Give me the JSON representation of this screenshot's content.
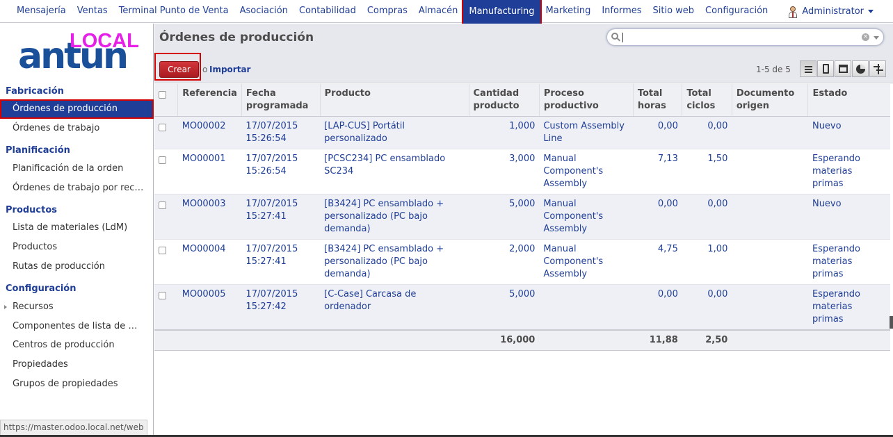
{
  "topbar": {
    "menu": [
      "Mensajería",
      "Ventas",
      "Terminal Punto de Venta",
      "Asociación",
      "Contabilidad",
      "Compras",
      "Almacén",
      "Manufacturing",
      "Marketing",
      "Informes",
      "Sitio web",
      "Configuración"
    ],
    "active": "Manufacturing",
    "user": "Administrator"
  },
  "logo": {
    "brand": "antun",
    "badge": "LOCAL"
  },
  "sidebar": {
    "sections": [
      {
        "title": "Fabricación",
        "items": [
          "Órdenes de producción",
          "Órdenes de trabajo"
        ]
      },
      {
        "title": "Planificación",
        "items": [
          "Planificación de la orden",
          "Órdenes de trabajo por rec…"
        ]
      },
      {
        "title": "Productos",
        "items": [
          "Lista de materiales (LdM)",
          "Productos",
          "Rutas de producción"
        ]
      },
      {
        "title": "Configuración",
        "items": [
          "Recursos",
          "Componentes de lista de …",
          "Centros de producción",
          "Propiedades",
          "Grupos de propiedades"
        ]
      }
    ],
    "active_item": "Órdenes de producción"
  },
  "header": {
    "title": "Órdenes de producción",
    "search_placeholder": "",
    "create_label": "Crear",
    "or_label": "o",
    "import_label": "Importar",
    "pager": "1-5 de 5"
  },
  "table": {
    "columns": [
      "Referencia",
      "Fecha programada",
      "Producto",
      "Cantidad producto",
      "Proceso productivo",
      "Total horas",
      "Total ciclos",
      "Documento origen",
      "Estado"
    ],
    "rows": [
      {
        "ref": "MO00002",
        "date": "17/07/2015",
        "time": "15:26:54",
        "product": "[LAP-CUS] Portátil personalizado",
        "qty": "1,000",
        "routing": "Custom Assembly Line",
        "hours": "0,00",
        "cycles": "0,00",
        "origin": "",
        "state": "Nuevo"
      },
      {
        "ref": "MO00001",
        "date": "17/07/2015",
        "time": "15:26:54",
        "product": "[PCSC234] PC ensamblado SC234",
        "qty": "3,000",
        "routing": "Manual Component's Assembly",
        "hours": "7,13",
        "cycles": "1,50",
        "origin": "",
        "state": "Esperando materias primas"
      },
      {
        "ref": "MO00003",
        "date": "17/07/2015",
        "time": "15:27:41",
        "product": "[B3424] PC ensamblado + personalizado (PC bajo demanda)",
        "qty": "5,000",
        "routing": "Manual Component's Assembly",
        "hours": "0,00",
        "cycles": "0,00",
        "origin": "",
        "state": "Nuevo"
      },
      {
        "ref": "MO00004",
        "date": "17/07/2015",
        "time": "15:27:41",
        "product": "[B3424] PC ensamblado + personalizado (PC bajo demanda)",
        "qty": "2,000",
        "routing": "Manual Component's Assembly",
        "hours": "4,75",
        "cycles": "1,00",
        "origin": "",
        "state": "Esperando materias primas"
      },
      {
        "ref": "MO00005",
        "date": "17/07/2015",
        "time": "15:27:42",
        "product": "[C-Case] Carcasa de ordenador",
        "qty": "5,000",
        "routing": "",
        "hours": "0,00",
        "cycles": "0,00",
        "origin": "",
        "state": "Esperando materias primas"
      }
    ],
    "totals": {
      "qty": "16,000",
      "hours": "11,88",
      "cycles": "2,50"
    }
  },
  "status_url": "https://master.odoo.local.net/web"
}
